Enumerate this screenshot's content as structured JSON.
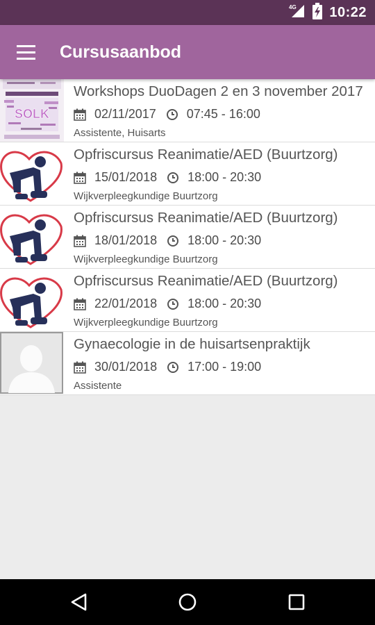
{
  "status": {
    "time": "10:22",
    "network": "4G"
  },
  "appbar": {
    "title": "Cursusaanbod",
    "menu_icon": "hamburger-menu-icon"
  },
  "colors": {
    "status_bar": "#5b3356",
    "app_bar": "#a0659d",
    "heart": "#d83a48",
    "figure": "#27305a"
  },
  "courses": [
    {
      "title": "Workshops DuoDagen 2 en 3 november 2017",
      "date": "02/11/2017",
      "time": "07:45 - 16:00",
      "category": "Assistente, Huisarts",
      "thumbnail": "workshop-flyer",
      "flyer_text": "SOLK"
    },
    {
      "title": "Opfriscursus Reanimatie/AED (Buurtzorg)",
      "date": "15/01/2018",
      "time": "18:00 - 20:30",
      "category": "Wijkverpleegkundige Buurtzorg",
      "thumbnail": "cpr-heart"
    },
    {
      "title": "Opfriscursus Reanimatie/AED (Buurtzorg)",
      "date": "18/01/2018",
      "time": "18:00 - 20:30",
      "category": "Wijkverpleegkundige Buurtzorg",
      "thumbnail": "cpr-heart"
    },
    {
      "title": "Opfriscursus Reanimatie/AED (Buurtzorg)",
      "date": "22/01/2018",
      "time": "18:00 - 20:30",
      "category": "Wijkverpleegkundige Buurtzorg",
      "thumbnail": "cpr-heart"
    },
    {
      "title": "Gynaecologie in de huisartsenpraktijk",
      "date": "30/01/2018",
      "time": "17:00 - 19:00",
      "category": "Assistente",
      "thumbnail": "avatar-placeholder"
    }
  ],
  "navbar": {
    "back": "back-triangle-icon",
    "home": "home-circle-icon",
    "recents": "recents-square-icon"
  }
}
